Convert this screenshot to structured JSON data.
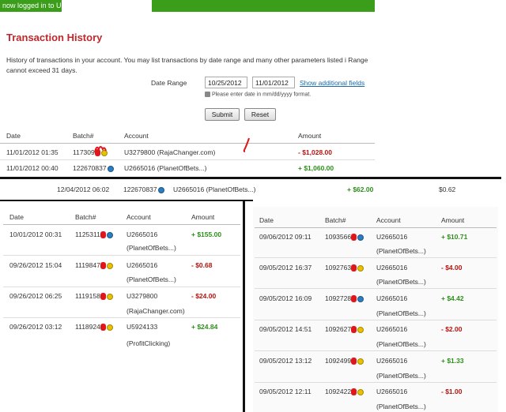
{
  "header": {
    "login_text": "now logged in to U"
  },
  "page": {
    "title": "Transaction History",
    "description": "History of transactions in your account. You may list transactions by date range and many other parameters listed i Range cannot exceed 31 days."
  },
  "filter": {
    "date_range_label": "Date Range",
    "date_from": "10/25/2012",
    "date_to": "11/01/2012",
    "show_fields_link": "Show additional fields",
    "hint": "Please enter date in mm/dd/yyyy format.",
    "submit_label": "Submit",
    "reset_label": "Reset"
  },
  "main_table": {
    "headers": {
      "date": "Date",
      "batch": "Batch#",
      "account": "Account",
      "amount": "Amount"
    },
    "rows": [
      {
        "date": "11/01/2012 01:35",
        "batch": "117309",
        "account": "U3279800 (RajaChanger.com)",
        "amount": "- $1,028.00"
      },
      {
        "date": "11/01/2012 00:40",
        "batch": "122670837",
        "account": "U2665016 (PlanetOfBets...)",
        "amount": "+ $1,060.00"
      }
    ]
  },
  "extra_row": {
    "date": "12/04/2012 06:02",
    "batch": "122670837",
    "account": "U2665016 (PlanetOfBets...)",
    "amount": "+ $62.00",
    "fee": "$0.62"
  },
  "left_table": {
    "headers": {
      "date": "Date",
      "batch": "Batch#",
      "account": "Account",
      "amount": "Amount"
    },
    "rows": [
      {
        "date": "10/01/2012 00:31",
        "batch": "1125311",
        "account": "U2665016",
        "account_sub": "(PlanetOfBets...)",
        "amount": "+ $155.00"
      },
      {
        "date": "09/26/2012 15:04",
        "batch": "1119847",
        "account": "U2665016",
        "account_sub": "(PlanetOfBets...)",
        "amount": "- $0.68"
      },
      {
        "date": "09/26/2012 06:25",
        "batch": "1119158",
        "account": "U3279800",
        "account_sub": "(RajaChanger.com)",
        "amount": "- $24.00"
      },
      {
        "date": "09/26/2012 03:12",
        "batch": "1118924",
        "account": "U5924133",
        "account_sub": "(ProfitClicking)",
        "amount": "+ $24.84"
      }
    ]
  },
  "right_table": {
    "headers": {
      "date": "Date",
      "batch": "Batch#",
      "account": "Account",
      "amount": "Amount"
    },
    "rows": [
      {
        "date": "09/06/2012 09:11",
        "batch": "1093566",
        "account": "U2665016",
        "account_sub": "(PlanetOfBets...)",
        "amount": "+ $10.71"
      },
      {
        "date": "09/05/2012 16:37",
        "batch": "1092763",
        "account": "U2665016",
        "account_sub": "(PlanetOfBets...)",
        "amount": "- $4.00"
      },
      {
        "date": "09/05/2012 16:09",
        "batch": "1092728",
        "account": "U2665016",
        "account_sub": "(PlanetOfBets...)",
        "amount": "+ $4.42"
      },
      {
        "date": "09/05/2012 14:51",
        "batch": "1092627",
        "account": "U2665016",
        "account_sub": "(PlanetOfBets...)",
        "amount": "- $2.00"
      },
      {
        "date": "09/05/2012 13:12",
        "batch": "1092499",
        "account": "U2665016",
        "account_sub": "(PlanetOfBets...)",
        "amount": "+ $1.33"
      },
      {
        "date": "09/05/2012 12:11",
        "batch": "1092422",
        "account": "U2665016",
        "account_sub": "(PlanetOfBets...)",
        "amount": "- $1.00"
      }
    ]
  },
  "colors": {
    "green_bar": "#3a9e1a",
    "title_red": "#c0272d",
    "negative": "#b3140f",
    "positive": "#2c8f1a",
    "link": "#1a6aa8"
  }
}
